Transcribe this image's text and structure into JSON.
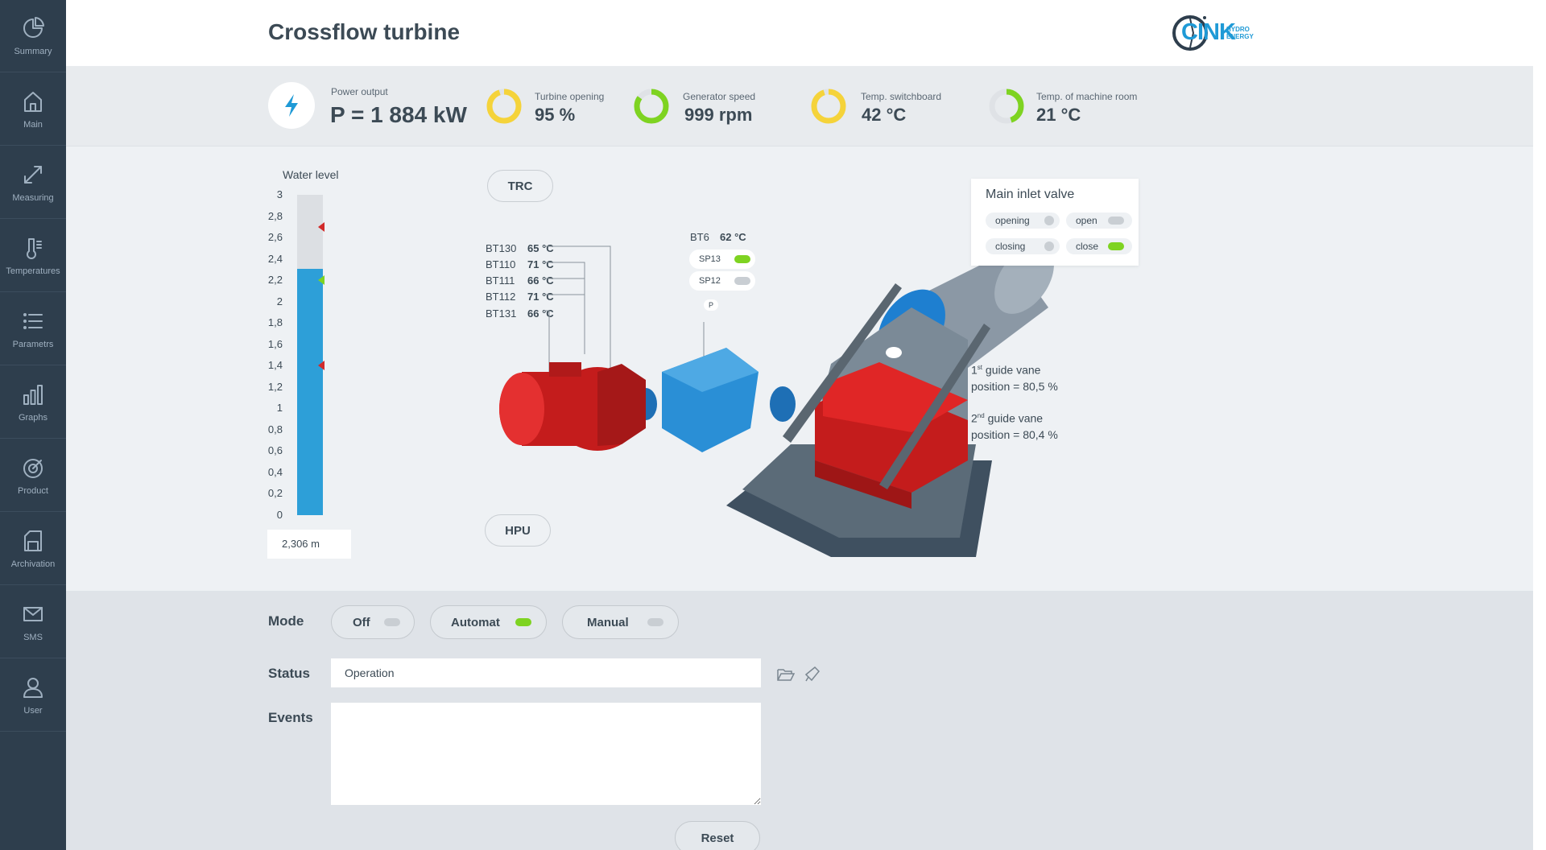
{
  "sidebar": {
    "items": [
      {
        "label": "Summary",
        "icon": "pie-chart-icon"
      },
      {
        "label": "Main",
        "icon": "home-icon"
      },
      {
        "label": "Measuring",
        "icon": "expand-arrows-icon"
      },
      {
        "label": "Temperatures",
        "icon": "thermometer-icon"
      },
      {
        "label": "Parametrs",
        "icon": "list-icon"
      },
      {
        "label": "Graphs",
        "icon": "bar-chart-icon"
      },
      {
        "label": "Product",
        "icon": "target-icon"
      },
      {
        "label": "Archivation",
        "icon": "archive-icon"
      },
      {
        "label": "SMS",
        "icon": "mail-icon"
      },
      {
        "label": "User",
        "icon": "user-icon"
      }
    ]
  },
  "header": {
    "title": "Crossflow turbine",
    "logo_text": "CINK",
    "logo_sub1": "HYDRO",
    "logo_sub2": "ENERGY"
  },
  "stats": {
    "power_label": "Power output",
    "power_value": "P = 1 884 kW",
    "turbine_label": "Turbine opening",
    "turbine_value": "95 %",
    "generator_label": "Generator speed",
    "generator_value": "999 rpm",
    "switchboard_label": "Temp. switchboard",
    "switchboard_value": "42 °C",
    "machine_label": "Temp. of machine room",
    "machine_value": "21 °C",
    "turbine_ring": 0.95,
    "generator_ring": 0.85,
    "switchboard_ring": 0.95,
    "machine_ring": 0.45,
    "colors": {
      "yellow": "#f5d33a",
      "green": "#7ed321",
      "ring_bg": "#dfe2e6",
      "accent": "#1f9ad6"
    }
  },
  "water_level": {
    "title": "Water level",
    "ticks": [
      "3",
      "2,8",
      "2,6",
      "2,4",
      "2,2",
      "2",
      "1,8",
      "1,6",
      "1,4",
      "1,2",
      "1",
      "0,8",
      "0,6",
      "0,4",
      "0,2",
      "0"
    ],
    "max": 3,
    "level": 2.306,
    "markers": [
      2.7,
      2.2,
      1.4
    ],
    "value_text": "2,306 m"
  },
  "buttons": {
    "trc": "TRC",
    "hpu": "HPU"
  },
  "sensors": [
    {
      "name": "BT130",
      "value": "65 °C"
    },
    {
      "name": "BT110",
      "value": "71 °C"
    },
    {
      "name": "BT111",
      "value": "66 °C"
    },
    {
      "name": "BT112",
      "value": "71 °C"
    },
    {
      "name": "BT131",
      "value": "66 °C"
    }
  ],
  "bt6": {
    "name": "BT6",
    "value": "62 °C"
  },
  "switches": {
    "sp13": "SP13",
    "sp12": "SP12",
    "p": "P"
  },
  "valve": {
    "title": "Main inlet valve",
    "opening": "opening",
    "open": "open",
    "closing": "closing",
    "close": "close"
  },
  "guide": {
    "g1_num": "1",
    "g1_sup": "st",
    "g1_label": "guide vane",
    "g1_pos": "position = 80,5 %",
    "g2_num": "2",
    "g2_sup": "nd",
    "g2_label": "guide vane",
    "g2_pos": "position = 80,4 %"
  },
  "mode": {
    "label": "Mode",
    "off": "Off",
    "automat": "Automat",
    "manual": "Manual"
  },
  "status": {
    "label": "Status",
    "value": "Operation"
  },
  "events": {
    "label": "Events"
  },
  "reset": "Reset"
}
